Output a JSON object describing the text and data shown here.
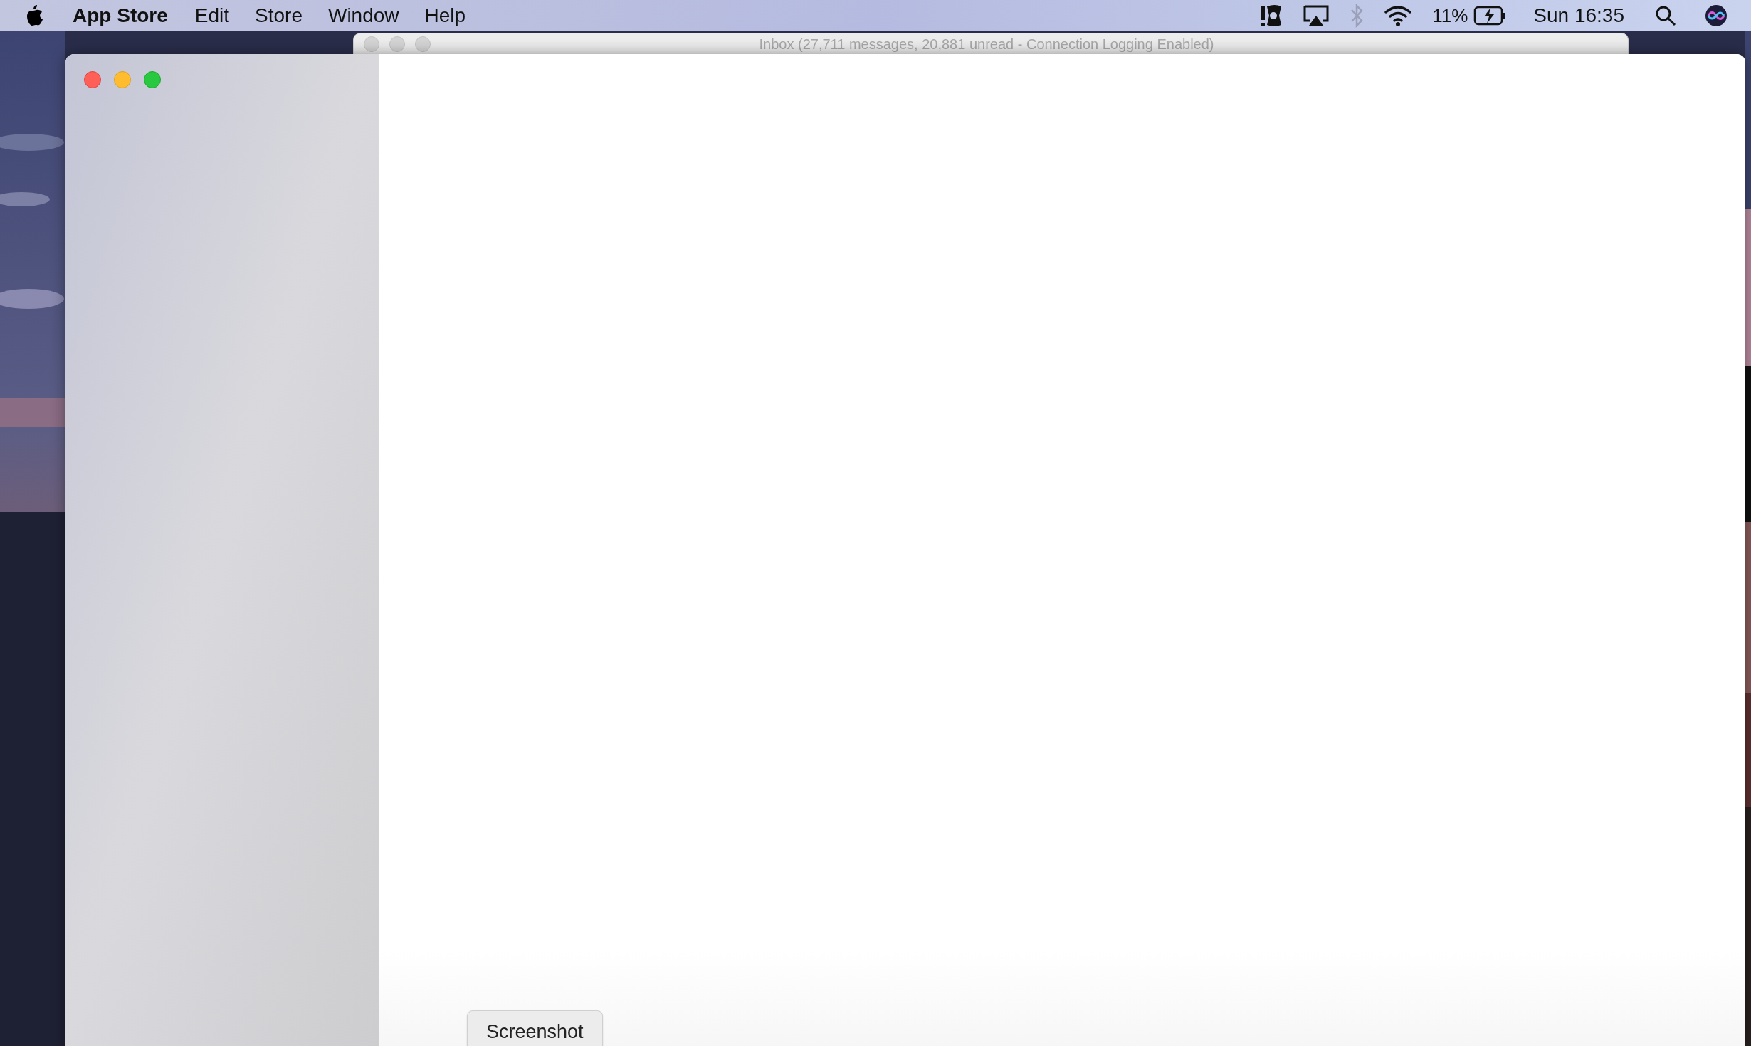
{
  "menu_bar": {
    "app_name": "App Store",
    "menus": [
      "Edit",
      "Store",
      "Window",
      "Help"
    ],
    "battery_percent": "11%",
    "clock": "Sun 16:35"
  },
  "background_window": {
    "title": "Inbox (27,711 messages, 20,881 unread - Connection Logging Enabled)"
  },
  "front_window": {
    "button": "Screenshot"
  }
}
